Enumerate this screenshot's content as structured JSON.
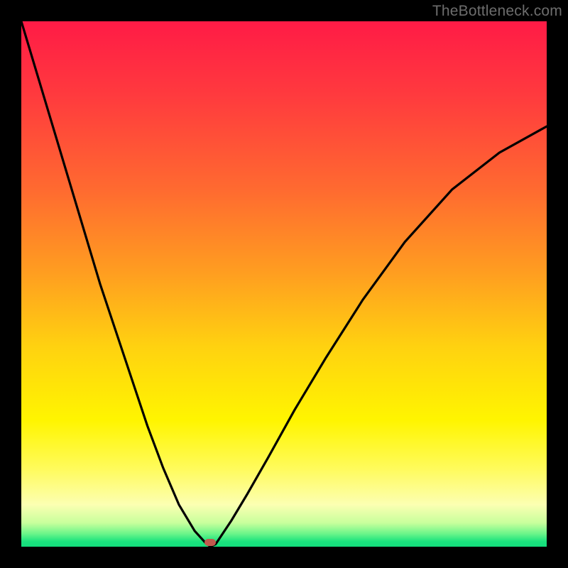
{
  "watermark": "TheBottleneck.com",
  "chart_data": {
    "type": "line",
    "title": "",
    "xlabel": "",
    "ylabel": "",
    "xlim": [
      0,
      100
    ],
    "ylim": [
      0,
      100
    ],
    "grid": false,
    "legend": false,
    "series": [
      {
        "name": "bottleneck-curve",
        "x": [
          0,
          3,
          6,
          9,
          12,
          15,
          18,
          21,
          24,
          27,
          30,
          33,
          35,
          36,
          37,
          38,
          40,
          43,
          47,
          52,
          58,
          65,
          73,
          82,
          91,
          100
        ],
        "values": [
          100,
          90,
          80,
          70,
          60,
          50,
          41,
          32,
          23,
          15,
          8,
          3,
          0.8,
          0,
          0.5,
          2,
          5,
          10,
          17,
          26,
          36,
          47,
          58,
          68,
          75,
          80
        ]
      }
    ],
    "annotations": [
      {
        "name": "optimal-point",
        "x": 36,
        "y": 0
      }
    ],
    "colors": {
      "curve": "#000000",
      "marker": "#c05a4e",
      "gradient_top": "#ff1b46",
      "gradient_mid": "#fff500",
      "gradient_bottom": "#13dd7c"
    }
  }
}
